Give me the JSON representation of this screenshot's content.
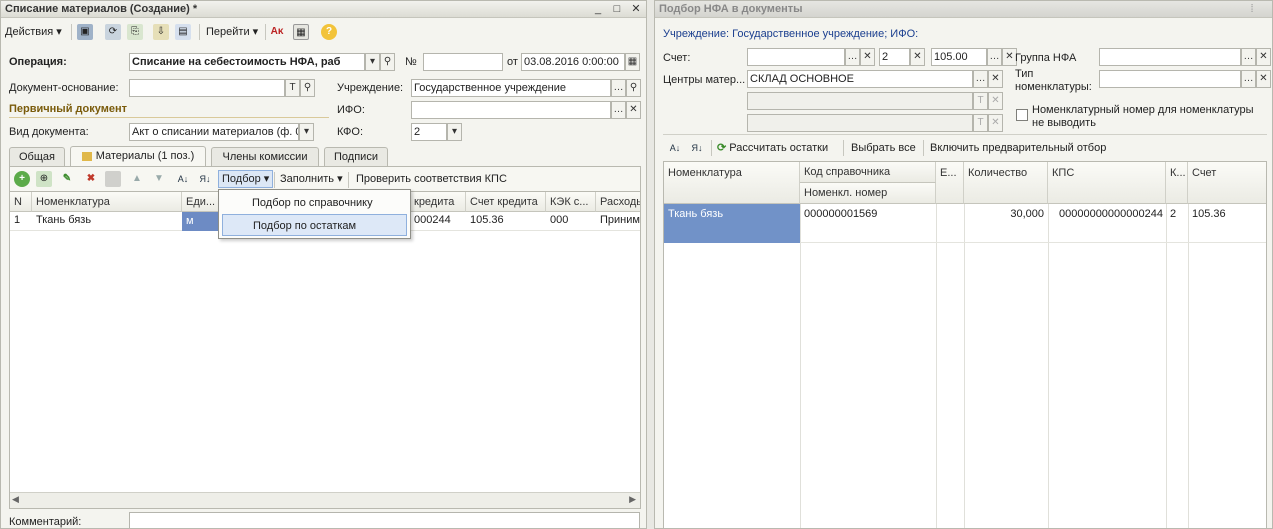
{
  "left": {
    "title": "Списание материалов (Создание) *",
    "titlebar_buttons": [
      "_",
      "□",
      "✕"
    ],
    "toolbar": {
      "actions": "Действия",
      "goto": "Перейти"
    },
    "form": {
      "operation_label": "Операция:",
      "operation_value": "Списание на себестоимость НФА, раб",
      "number_label": "№",
      "number_value": "",
      "date_label": "от",
      "date_value": "03.08.2016 0:00:00",
      "basis_label": "Документ-основание:",
      "basis_value": "",
      "institution_label": "Учреждение:",
      "institution_value": "Государственное учреждение",
      "primary_doc_label": "Первичный документ",
      "ifo_label": "ИФО:",
      "ifo_value": "",
      "doc_type_label": "Вид документа:",
      "doc_type_value": "Акт о списании материалов (ф. 0",
      "kfo_label": "КФО:",
      "kfo_value": "2"
    },
    "tabs": [
      "Общая",
      "Материалы (1 поз.)",
      "Члены комиссии",
      "Подписи"
    ],
    "table_toolbar": {
      "pick": "Подбор",
      "fill": "Заполнить",
      "check": "Проверить соответствия КПС"
    },
    "columns": [
      "N",
      "Номенклатура",
      "Еди...",
      "",
      "кредита",
      "Счет кредита",
      "КЭК с...",
      "Расходы"
    ],
    "rows": [
      {
        "n": "1",
        "name": "Ткань бязь",
        "unit": "м",
        "kps": "000244",
        "account": "105.36",
        "kek": "000",
        "expense": "Приним"
      }
    ],
    "menu": [
      "Подбор по справочнику",
      "Подбор по остаткам"
    ],
    "comment_label": "Комментарий:"
  },
  "right": {
    "title": "Подбор НФА в документы",
    "header_info": "Учреждение: Государственное учреждение; ИФО:",
    "account_label": "Счет:",
    "account_kfo": "2",
    "account_value": "105.00",
    "centers_label": "Центры матер...",
    "centers_value": "СКЛАД ОСНОВНОЕ",
    "group_label": "Группа НФА",
    "nomtype_label": "Тип номенклатуры:",
    "checkbox_label": "Номенклатурный номер для номенклатуры не выводить",
    "toolbar": {
      "calc": "Рассчитать остатки",
      "select_all": "Выбрать все",
      "prefilter": "Включить предварительный отбор"
    },
    "columns": [
      "Номенклатура",
      "Код справочника",
      "Номенкл. номер",
      "Е...",
      "Количество",
      "КПС",
      "К...",
      "Счет"
    ],
    "rows": [
      {
        "name": "Ткань бязь",
        "code": "000000001569",
        "qty": "30,000",
        "kps": "00000000000000244",
        "k": "2",
        "account": "105.36"
      }
    ]
  }
}
